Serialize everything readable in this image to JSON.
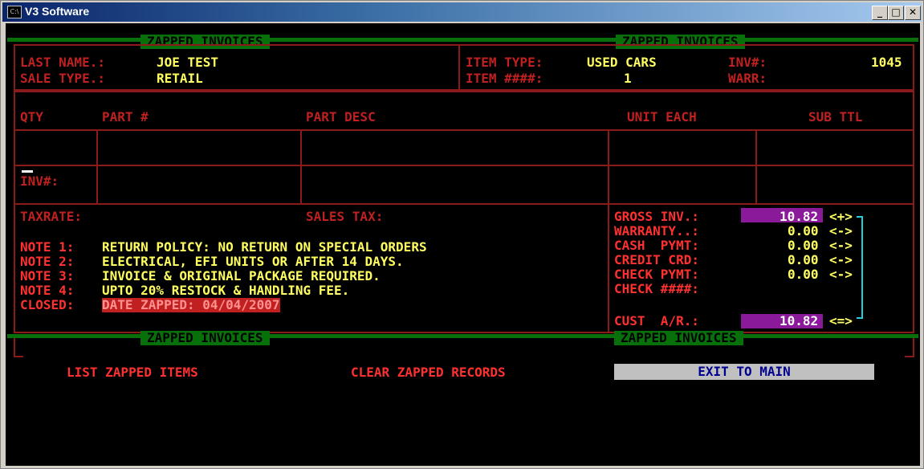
{
  "window": {
    "title": "V3 Software",
    "icon_text": "C:\\"
  },
  "header_left": {
    "title": "ZAPPED INVOICES",
    "last_name_label": "LAST NAME.:",
    "last_name_value": "JOE TEST",
    "sale_type_label": "SALE TYPE.:",
    "sale_type_value": "RETAIL"
  },
  "header_right": {
    "title": "ZAPPED INVOICES",
    "item_type_label": "ITEM TYPE:",
    "item_type_value": "USED CARS",
    "inv_label": "INV#:",
    "inv_value": "1045",
    "item_num_label": "ITEM ####:",
    "item_num_value": "1",
    "warr_label": "WARR:"
  },
  "columns": {
    "qty": "QTY",
    "part_num": "PART #",
    "part_desc": "PART DESC",
    "unit_each": "UNIT EACH",
    "sub_ttl": "SUB TTL"
  },
  "inv_cursor_label": "INV#:",
  "tax": {
    "taxrate_label": "TAXRATE:",
    "sales_tax_label": "SALES TAX:"
  },
  "notes": [
    {
      "label": "NOTE 1:",
      "text": "RETURN POLICY: NO RETURN ON SPECIAL ORDERS"
    },
    {
      "label": "NOTE 2:",
      "text": "ELECTRICAL, EFI UNITS OR AFTER 14 DAYS."
    },
    {
      "label": "NOTE 3:",
      "text": "INVOICE & ORIGINAL PACKAGE REQUIRED."
    },
    {
      "label": "NOTE 4:",
      "text": "UPTO 20% RESTOCK & HANDLING FEE."
    }
  ],
  "closed": {
    "label": "CLOSED:",
    "value": "DATE ZAPPED: 04/04/2007"
  },
  "totals": [
    {
      "label": "GROSS INV.:",
      "value": "10.82",
      "sign": "<+>"
    },
    {
      "label": "WARRANTY..:",
      "value": "0.00",
      "sign": "<->"
    },
    {
      "label": "CASH  PYMT:",
      "value": "0.00",
      "sign": "<->"
    },
    {
      "label": "CREDIT CRD:",
      "value": "0.00",
      "sign": "<->"
    },
    {
      "label": "CHECK PYMT:",
      "value": "0.00",
      "sign": "<->"
    },
    {
      "label": "CHECK ####:",
      "value": "",
      "sign": ""
    },
    {
      "label": "CUST  A/R.:",
      "value": "10.82",
      "sign": "<=>"
    }
  ],
  "footer_left_title": "ZAPPED INVOICES",
  "footer_right_title": "ZAPPED INVOICES",
  "actions": {
    "list": "LIST ZAPPED ITEMS",
    "clear": "CLEAR ZAPPED RECORDS",
    "exit": "EXIT TO MAIN"
  }
}
